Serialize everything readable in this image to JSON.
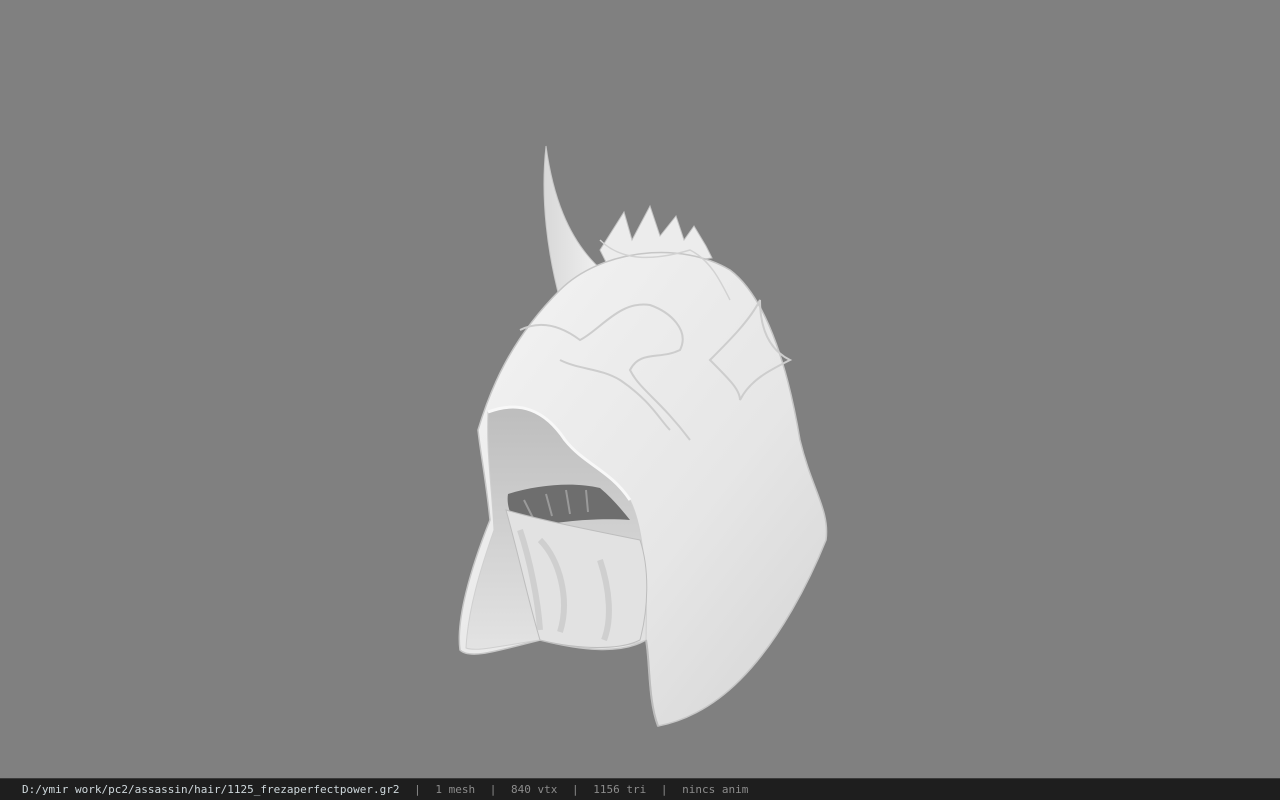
{
  "status": {
    "file_path": "D:/ymir work/pc2/assassin/hair/1125_frezaperfectpower.gr2",
    "separator": "|",
    "mesh_count": "1 mesh",
    "vertex_count": "840 vtx",
    "triangle_count": "1156 tri",
    "animation": "nincs anim"
  },
  "colors": {
    "background": "#808080",
    "statusbar": "#1e1e1e",
    "model": "#e8e8e8"
  },
  "viewport": {
    "model_icon": "hooded-helmet-3d-model"
  }
}
